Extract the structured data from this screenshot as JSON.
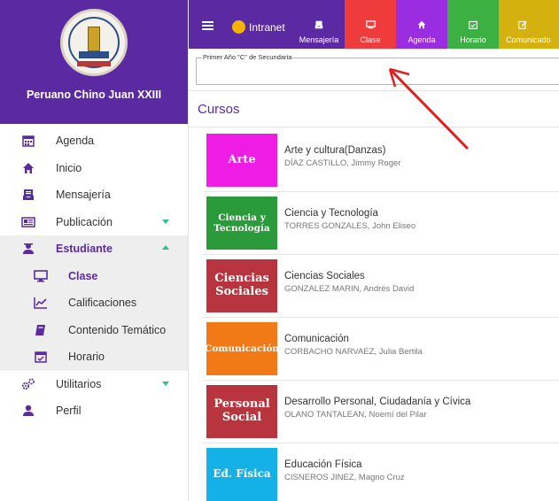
{
  "sidebar": {
    "school_name": "Peruano Chino Juan XXIII",
    "items": [
      {
        "label": "Agenda",
        "icon": "calendar-icon"
      },
      {
        "label": "Inicio",
        "icon": "home-icon"
      },
      {
        "label": "Mensajería",
        "icon": "inbox-icon"
      },
      {
        "label": "Publicación",
        "icon": "newspaper-icon"
      },
      {
        "label": "Estudiante",
        "icon": "student-icon"
      },
      {
        "label": "Clase",
        "icon": "monitor-icon"
      },
      {
        "label": "Calificaciones",
        "icon": "chart-line-icon"
      },
      {
        "label": "Contenido Temático",
        "icon": "book-icon"
      },
      {
        "label": "Horario",
        "icon": "calendar-check-icon"
      },
      {
        "label": "Utilitarios",
        "icon": "cogs-icon"
      },
      {
        "label": "Perfil",
        "icon": "user-icon"
      }
    ]
  },
  "topbar": {
    "intranet_label": "Intranet",
    "tabs": [
      {
        "label": "Mensajería",
        "color": "#5b2aa3",
        "icon": "inbox-icon"
      },
      {
        "label": "Clase",
        "color": "#ef3b3b",
        "icon": "monitor-icon"
      },
      {
        "label": "Agenda",
        "color": "#9b2de0",
        "icon": "home-icon"
      },
      {
        "label": "Horario",
        "color": "#3cb043",
        "icon": "calendar-check-icon"
      },
      {
        "label": "Comunicado",
        "color": "#d4b10f",
        "icon": "edit-icon"
      }
    ]
  },
  "main": {
    "grade_legend": "Primer Año \"C\" de Secundaria",
    "section_title": "Cursos",
    "courses": [
      {
        "box_label": "Arte",
        "box_color": "#ee1ce5",
        "name": "Arte y cultura(Danzas)",
        "teacher": "DÍAZ CASTILLO, Jimmy Roger"
      },
      {
        "box_label": "Ciencia y Tecnología",
        "box_color": "#2a9a3a",
        "name": "Ciencia y Tecnología",
        "teacher": "TORRES GONZALES, John Eliseo"
      },
      {
        "box_label": "Ciencias Sociales",
        "box_color": "#b8343f",
        "name": "Ciencias Sociales",
        "teacher": "GONZALEZ MARIN, Andrés David"
      },
      {
        "box_label": "Comunicación",
        "box_color": "#f27a16",
        "name": "Comunicación",
        "teacher": "CORBACHO NARVAEZ, Julia Bertila"
      },
      {
        "box_label": "Personal Social",
        "box_color": "#b8343f",
        "name": "Desarrollo Personal, Ciudadanía y Cívica",
        "teacher": "OLANO TANTALEAN, Noemí del Pilar"
      },
      {
        "box_label": "Ed. Física",
        "box_color": "#13b1e6",
        "name": "Educación Física",
        "teacher": "CISNEROS JINEZ, Magno Cruz"
      }
    ]
  },
  "colors": {
    "brand": "#5b2aa3",
    "accent": "#2ebf8a",
    "annotation_arrow": "#e02020"
  }
}
